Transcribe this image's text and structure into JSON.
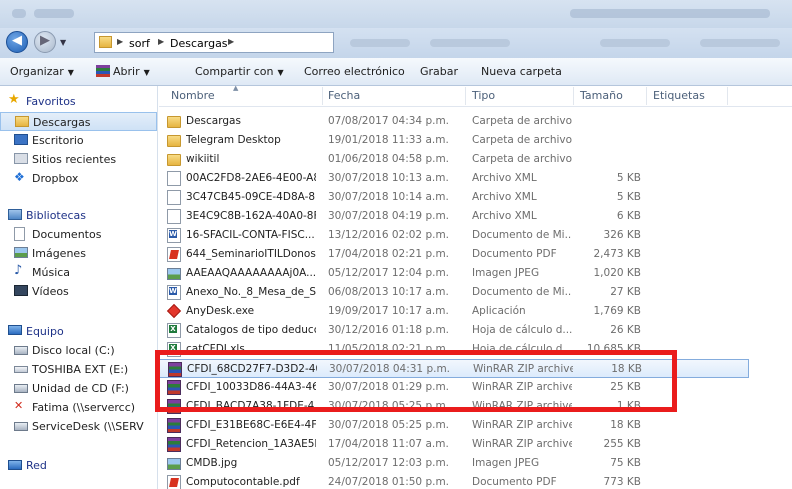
{
  "breadcrumb": [
    "sorf",
    "Descargas"
  ],
  "toolbar": {
    "organize": "Organizar",
    "open": "Abrir",
    "share": "Compartir con",
    "email": "Correo electrónico",
    "burn": "Grabar",
    "new_folder": "Nueva carpeta"
  },
  "nav": {
    "favorites": "Favoritos",
    "favorites_items": [
      "Descargas",
      "Escritorio",
      "Sitios recientes",
      "Dropbox"
    ],
    "libraries": "Bibliotecas",
    "libraries_items": [
      "Documentos",
      "Imágenes",
      "Música",
      "Vídeos"
    ],
    "computer": "Equipo",
    "computer_items": [
      "Disco local (C:)",
      "TOSHIBA EXT (E:)",
      "Unidad de CD (F:)",
      "Fatima (\\\\servercc)",
      "ServiceDesk (\\\\SERV"
    ],
    "network": "Red"
  },
  "columns": [
    "Nombre",
    "Fecha",
    "Tipo",
    "Tamaño",
    "Etiquetas"
  ],
  "files": [
    {
      "icon": "folder-icon",
      "name": "Descargas",
      "date": "07/08/2017 04:34 p.m.",
      "type": "Carpeta de archivos",
      "size": ""
    },
    {
      "icon": "folder-icon",
      "name": "Telegram Desktop",
      "date": "19/01/2018 11:33 a.m.",
      "type": "Carpeta de archivos",
      "size": ""
    },
    {
      "icon": "folder-icon",
      "name": "wikiitil",
      "date": "01/06/2018 04:58 p.m.",
      "type": "Carpeta de archivos",
      "size": ""
    },
    {
      "icon": "xml-file-icon",
      "name": "00AC2FD8-2AE6-4E00-A8...",
      "date": "30/07/2018 10:13 a.m.",
      "type": "Archivo XML",
      "size": "5 KB"
    },
    {
      "icon": "xml-file-icon",
      "name": "3C47CB45-09CE-4D8A-8E...",
      "date": "30/07/2018 10:14 a.m.",
      "type": "Archivo XML",
      "size": "5 KB"
    },
    {
      "icon": "xml-file-icon",
      "name": "3E4C9C8B-162A-40A0-8F...",
      "date": "30/07/2018 04:19 p.m.",
      "type": "Archivo XML",
      "size": "6 KB"
    },
    {
      "icon": "word-file-icon",
      "name": "16-SFACIL-CONTA-FISC...",
      "date": "13/12/2016 02:02 p.m.",
      "type": "Documento de Mi...",
      "size": "326 KB"
    },
    {
      "icon": "pdf-file-icon",
      "name": "644_SeminarioITILDonost...",
      "date": "17/04/2018 02:21 p.m.",
      "type": "Documento PDF",
      "size": "2,473 KB"
    },
    {
      "icon": "image-file-icon",
      "name": "AAEAAQAAAAAAAAj0A...",
      "date": "05/12/2017 12:04 p.m.",
      "type": "Imagen JPEG",
      "size": "1,020 KB"
    },
    {
      "icon": "word-file-icon",
      "name": "Anexo_No._8_Mesa_de_S...",
      "date": "06/08/2013 10:17 a.m.",
      "type": "Documento de Mi...",
      "size": "27 KB"
    },
    {
      "icon": "anydesk-icon",
      "name": "AnyDesk.exe",
      "date": "19/09/2017 10:17 a.m.",
      "type": "Aplicación",
      "size": "1,769 KB"
    },
    {
      "icon": "excel-file-icon",
      "name": "Catalogos de tipo deducc...",
      "date": "30/12/2016 01:18 p.m.",
      "type": "Hoja de cálculo d...",
      "size": "26 KB"
    },
    {
      "icon": "excel-file-icon",
      "name": "catCFDI.xls",
      "date": "11/05/2018 02:21 p.m.",
      "type": "Hoja de cálculo d...",
      "size": "10,685 KB"
    },
    {
      "icon": "rar-file-icon",
      "name": "CFDI_68CD27F7-D3D2-40...",
      "date": "30/07/2018 04:31 p.m.",
      "type": "WinRAR ZIP archive",
      "size": "18 KB"
    },
    {
      "icon": "rar-file-icon",
      "name": "CFDI_10033D86-44A3-467...",
      "date": "30/07/2018 01:29 p.m.",
      "type": "WinRAR ZIP archive",
      "size": "25 KB"
    },
    {
      "icon": "rar-file-icon",
      "name": "CFDI_BACD7A38-1FDE-4...",
      "date": "30/07/2018 05:25 p.m.",
      "type": "WinRAR ZIP archive",
      "size": "1 KB"
    },
    {
      "icon": "rar-file-icon",
      "name": "CFDI_E31BE68C-E6E4-4FD...",
      "date": "30/07/2018 05:25 p.m.",
      "type": "WinRAR ZIP archive",
      "size": "18 KB"
    },
    {
      "icon": "rar-file-icon",
      "name": "CFDI_Retencion_1A3AE5F...",
      "date": "17/04/2018 11:07 a.m.",
      "type": "WinRAR ZIP archive",
      "size": "255 KB"
    },
    {
      "icon": "image-file-icon",
      "name": "CMDB.jpg",
      "date": "05/12/2017 12:03 p.m.",
      "type": "Imagen JPEG",
      "size": "75 KB"
    },
    {
      "icon": "pdf-file-icon",
      "name": "Computocontable.pdf",
      "date": "24/07/2018 01:50 p.m.",
      "type": "Documento PDF",
      "size": "773 KB"
    }
  ],
  "selected_row": 13,
  "colors": {
    "highlight": "#ea1c1c",
    "selection": "#dcebfc",
    "link": "#1e3287"
  }
}
